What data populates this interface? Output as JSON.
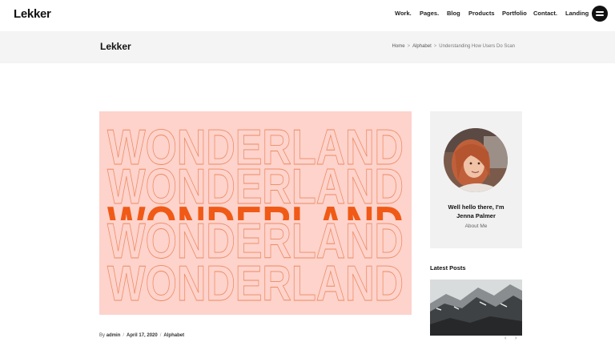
{
  "header": {
    "logo": "Lekker",
    "nav": [
      {
        "label": "Work."
      },
      {
        "label": "Pages."
      },
      {
        "label": "Blog"
      },
      {
        "label": "Products"
      },
      {
        "label": "Portfolio"
      },
      {
        "label": "Contact."
      },
      {
        "label": "Landing"
      }
    ],
    "menu_icon": "hamburger-icon"
  },
  "titlebar": {
    "title": "Lekker",
    "breadcrumb": [
      "Home",
      "Alphabet",
      "Understanding How Users Do Scan"
    ],
    "separator": ">"
  },
  "post": {
    "image_words": [
      "WONDERLAND",
      "WONDERLAND",
      "WONDERLAND",
      "WONDERLAND",
      "WONDERLAND"
    ],
    "meta": {
      "by": "By",
      "author": "admin",
      "separator": "/",
      "date": "April 17, 2020",
      "category": "Alphabet"
    }
  },
  "sidebar": {
    "about": {
      "greeting_line1": "Well hello there, I'm",
      "greeting_line2": "Jenna Palmer",
      "link": "About Me"
    },
    "latest_posts": {
      "heading": "Latest Posts",
      "prev": "‹",
      "next": "›"
    }
  },
  "colors": {
    "hero_bg": "#fdd3cc",
    "accent_orange": "#f05a16",
    "outline_orange": "#ef8a60",
    "titlebar_bg": "#f4f4f4",
    "card_bg": "#f1f1f1"
  }
}
